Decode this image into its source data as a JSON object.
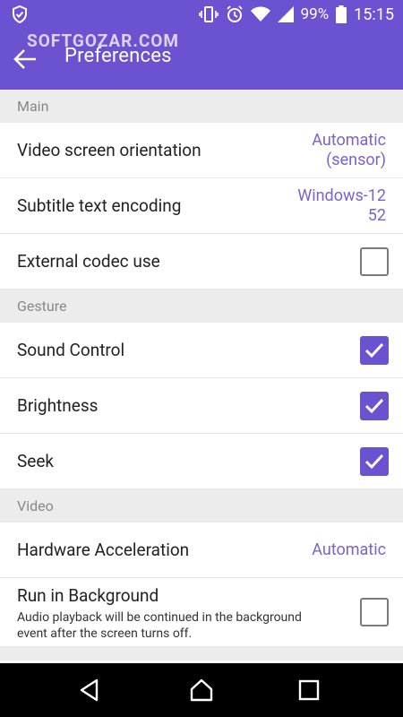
{
  "status": {
    "battery": "99%",
    "time": "15:15"
  },
  "app": {
    "title": "Preferences",
    "watermark": "SOFTGOZAR.COM"
  },
  "sections": {
    "main": "Main",
    "gesture": "Gesture",
    "video": "Video"
  },
  "rows": {
    "orientation": {
      "label": "Video screen orientation",
      "value": "Automatic\n(sensor)"
    },
    "encoding": {
      "label": "Subtitle text encoding",
      "value": "Windows-12\n52"
    },
    "codec": {
      "label": "External codec use",
      "checked": false
    },
    "sound": {
      "label": "Sound Control",
      "checked": true
    },
    "brightness": {
      "label": "Brightness",
      "checked": true
    },
    "seek": {
      "label": "Seek",
      "checked": true
    },
    "hwaccel": {
      "label": "Hardware Acceleration",
      "value": "Automatic"
    },
    "background": {
      "label": "Run in Background",
      "desc": "Audio playback will be continued in the background event after the screen turns off.",
      "checked": false
    }
  },
  "colors": {
    "accent": "#6b52d0",
    "value_text": "#7a62d0"
  }
}
